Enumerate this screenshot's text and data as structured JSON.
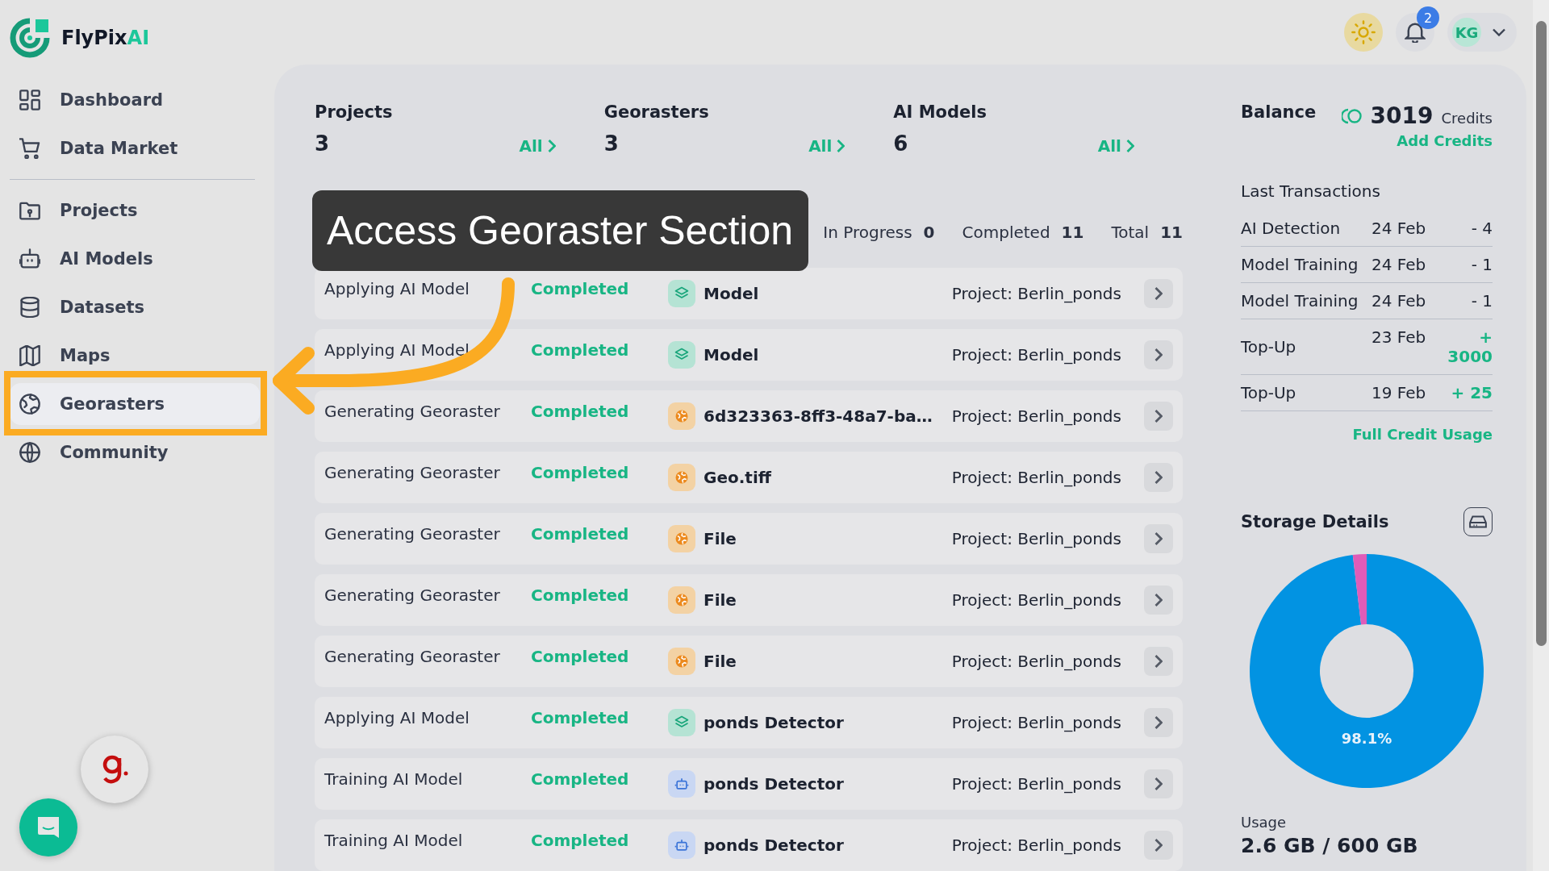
{
  "brand": {
    "name": "FlyPix",
    "suffix": "AI"
  },
  "sidebar": {
    "items": [
      {
        "label": "Dashboard",
        "selected": false
      },
      {
        "label": "Data Market",
        "selected": false
      },
      {
        "label": "Projects",
        "selected": false
      },
      {
        "label": "AI Models",
        "selected": false
      },
      {
        "label": "Datasets",
        "selected": false
      },
      {
        "label": "Maps",
        "selected": false
      },
      {
        "label": "Georasters",
        "selected": true
      },
      {
        "label": "Community",
        "selected": false
      }
    ]
  },
  "header": {
    "notifications": "2",
    "avatar": "KG"
  },
  "stats": [
    {
      "label": "Projects",
      "value": "3",
      "link": "All"
    },
    {
      "label": "Georasters",
      "value": "3",
      "link": "All"
    },
    {
      "label": "AI Models",
      "value": "6",
      "link": "All"
    }
  ],
  "processing": {
    "counts": [
      {
        "label": "In Progress",
        "value": "0"
      },
      {
        "label": "Completed",
        "value": "11"
      },
      {
        "label": "Total",
        "value": "11"
      }
    ],
    "rows": [
      {
        "task": "Applying AI Model",
        "status": "Completed",
        "kind": "model",
        "name": "Model",
        "project": "Project: Berlin_ponds"
      },
      {
        "task": "Applying AI Model",
        "status": "Completed",
        "kind": "model",
        "name": "Model",
        "project": "Project: Berlin_ponds"
      },
      {
        "task": "Generating Georaster",
        "status": "Completed",
        "kind": "georaster",
        "name": "6d323363-8ff3-48a7-ba…",
        "project": "Project: Berlin_ponds"
      },
      {
        "task": "Generating Georaster",
        "status": "Completed",
        "kind": "georaster",
        "name": "Geo.tiff",
        "project": "Project: Berlin_ponds"
      },
      {
        "task": "Generating Georaster",
        "status": "Completed",
        "kind": "georaster",
        "name": "File",
        "project": "Project: Berlin_ponds"
      },
      {
        "task": "Generating Georaster",
        "status": "Completed",
        "kind": "georaster",
        "name": "File",
        "project": "Project: Berlin_ponds"
      },
      {
        "task": "Generating Georaster",
        "status": "Completed",
        "kind": "georaster",
        "name": "File",
        "project": "Project: Berlin_ponds"
      },
      {
        "task": "Applying AI Model",
        "status": "Completed",
        "kind": "model",
        "name": "ponds Detector",
        "project": "Project: Berlin_ponds"
      },
      {
        "task": "Training AI Model",
        "status": "Completed",
        "kind": "training",
        "name": "ponds Detector",
        "project": "Project: Berlin_ponds"
      },
      {
        "task": "Training AI Model",
        "status": "Completed",
        "kind": "training",
        "name": "ponds Detector",
        "project": "Project: Berlin_ponds"
      }
    ]
  },
  "balance": {
    "title": "Balance",
    "amount": "3019",
    "unit": "Credits",
    "add_link": "Add Credits"
  },
  "transactions": {
    "title": "Last Transactions",
    "items": [
      {
        "type": "AI Detection",
        "date": "24 Feb",
        "amount": "- 4",
        "kind": "debit"
      },
      {
        "type": "Model Training",
        "date": "24 Feb",
        "amount": "- 1",
        "kind": "debit"
      },
      {
        "type": "Model Training",
        "date": "24 Feb",
        "amount": "- 1",
        "kind": "debit"
      },
      {
        "type": "Top-Up",
        "date": "23 Feb",
        "amount": "+ 3000",
        "kind": "credit"
      },
      {
        "type": "Top-Up",
        "date": "19 Feb",
        "amount": "+ 25",
        "kind": "credit"
      }
    ],
    "link": "Full Credit Usage"
  },
  "storage": {
    "title": "Storage Details",
    "chart_data": {
      "type": "donut",
      "values": [
        98.1,
        1.9
      ]
    },
    "label": "98.1%",
    "usage_label": "Usage",
    "usage": "2.6 GB / 600 GB"
  },
  "tooltip": {
    "text": "Access Georaster Section"
  }
}
